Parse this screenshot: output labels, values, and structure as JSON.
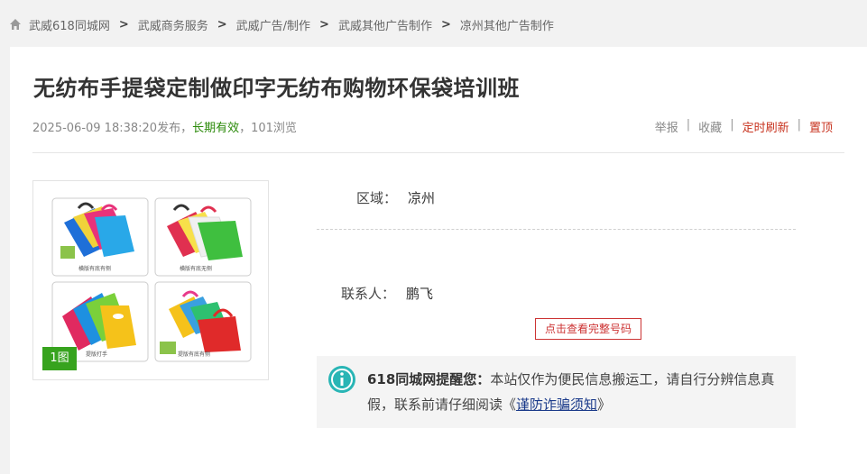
{
  "breadcrumb": {
    "items": [
      "武威618同城网",
      "武威商务服务",
      "武威广告/制作",
      "武威其他广告制作",
      "凉州其他广告制作"
    ],
    "separator": ">"
  },
  "post": {
    "title": "无纺布手提袋定制做印字无纺布购物环保袋培训班",
    "datetime": "2025-06-09 18:38:20",
    "published_suffix": "发布，",
    "validity": "长期有效",
    "views": "，101浏览"
  },
  "actions": {
    "report": "举报",
    "favorite": "收藏",
    "scheduled_refresh": "定时刷新",
    "pin_top": "置顶",
    "separator": "|"
  },
  "gallery": {
    "count_label": "1图",
    "captions": [
      "横版有底有侧",
      "横版有底无侧",
      "提版打手",
      "提版有底有侧"
    ]
  },
  "details": {
    "area_label": "区域：",
    "area_value": "凉州",
    "contact_label": "联系人：",
    "contact_value": "鹏飞",
    "phone_button": "点击查看完整号码"
  },
  "notice": {
    "brand": "618同城网提醒您：",
    "body": "本站仅作为便民信息搬运工，请自行分辨信息真假，联系前请仔细阅读",
    "link": "谨防诈骗须知",
    "open_quote": "《",
    "close_quote": "》"
  },
  "colors": {
    "valid_green": "#2b8a0a",
    "action_red": "#c83420",
    "badge_green": "#37a31e",
    "info_teal": "#29b5b5"
  }
}
